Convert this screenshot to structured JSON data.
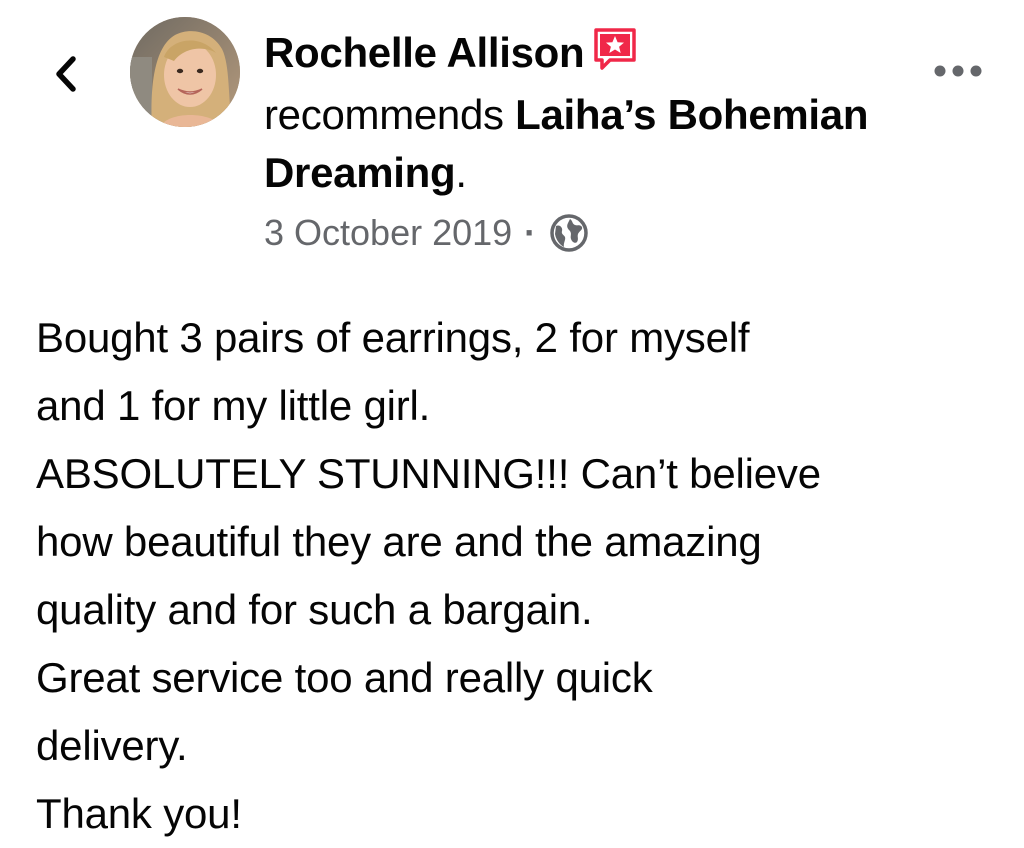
{
  "post": {
    "author": "Rochelle Allison",
    "recommends_word": "recommends",
    "page_name": "Laiha’s Bohemian Dreaming",
    "period": ".",
    "date": "3 October 2019",
    "separator": "·",
    "privacy_icon": "globe-icon",
    "body_lines": [
      "Bought 3 pairs of earrings, 2 for myself",
      "and 1 for my little girl.",
      "ABSOLUTELY STUNNING!!! Can’t believe",
      "how beautiful they are and the amazing",
      "quality and for such a bargain.",
      "Great service too and really quick",
      "delivery.",
      "Thank you!"
    ]
  },
  "header": {
    "back_icon": "chevron-left-icon",
    "more_icon": "more-horizontal-icon",
    "recommendation_icon": "recommendation-star-icon"
  },
  "colors": {
    "text": "#050505",
    "secondary": "#65676b",
    "recommend_badge": "#f02849"
  }
}
